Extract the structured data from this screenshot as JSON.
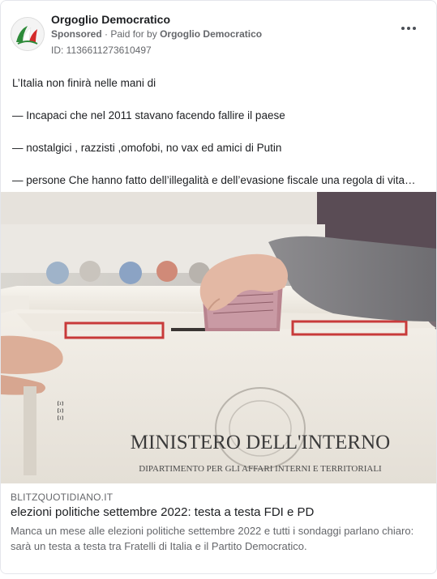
{
  "ad": {
    "page_name": "Orgoglio Democratico",
    "sponsored": "Sponsored",
    "paid_prefix": "Paid for by",
    "paid_by": "Orgoglio Democratico",
    "ad_id": "ID: 1136611273610497",
    "more_icon": "more-options-icon"
  },
  "post": {
    "lines": [
      "L’Italia non finirà nelle mani di",
      "— Incapaci che nel 2011 stavano facendo fallire il paese",
      "— nostalgici , razzisti ,omofobi, no vax ed amici di Putin",
      "— persone Che hanno fatto dell’illegalità e dell’evasione fiscale una regola di vita…"
    ]
  },
  "image": {
    "box_text_line1": "MINISTERO DELL'INTERNO",
    "box_text_line2": "DIPARTIMENTO PER GLI AFFARI INTERNI E TERRITORIALI"
  },
  "link": {
    "domain": "BLITZQUOTIDIANO.IT",
    "headline": "elezioni politiche settembre 2022: testa a testa FDI e PD",
    "description": "Manca un mese alle elezioni politiche settembre 2022 e tutti i sondaggi parlano chiaro: sarà un testa a testa tra Fratelli di Italia e il Partito Democratico."
  }
}
